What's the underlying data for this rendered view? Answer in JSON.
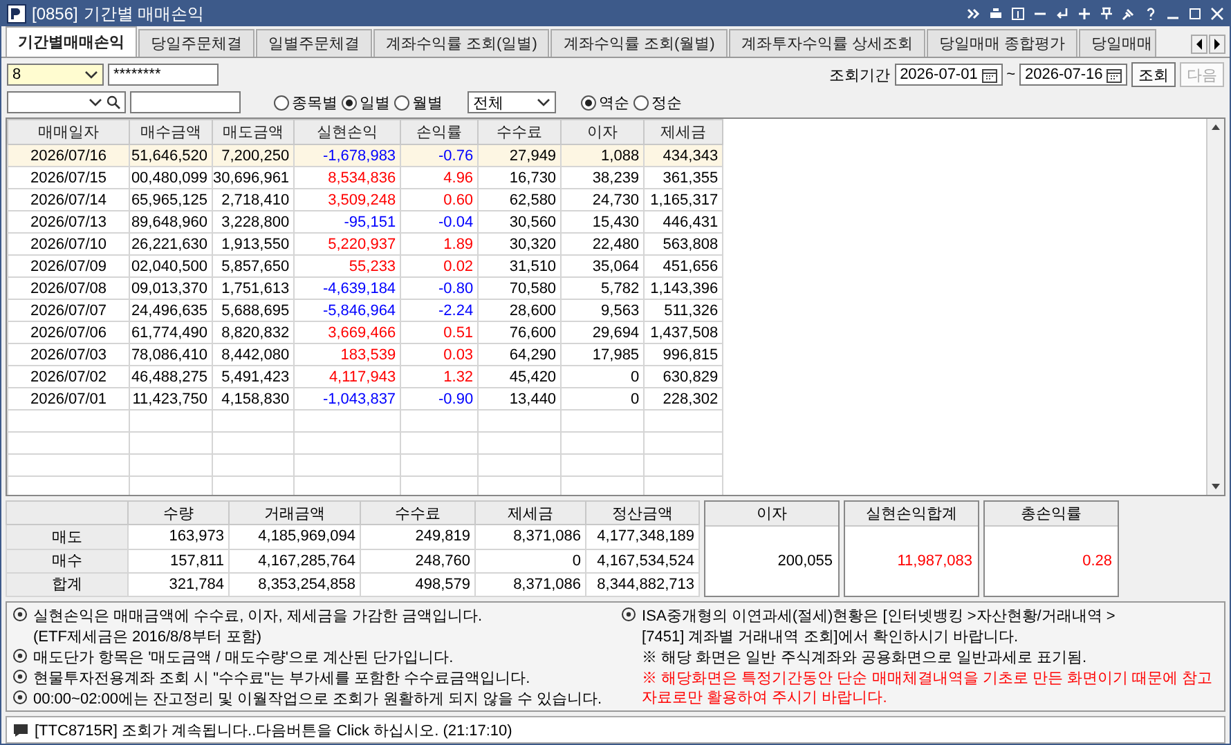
{
  "window": {
    "code": "[0856]",
    "title": "기간별 매매손익"
  },
  "tabs": [
    {
      "label": "기간별매매손익",
      "selected": true
    },
    {
      "label": "당일주문체결",
      "selected": false
    },
    {
      "label": "일별주문체결",
      "selected": false
    },
    {
      "label": "계좌수익률 조회(일별)",
      "selected": false
    },
    {
      "label": "계좌수익률 조회(월별)",
      "selected": false
    },
    {
      "label": "계좌투자수익률 상세조회",
      "selected": false
    },
    {
      "label": "당일매매 종합평가",
      "selected": false
    },
    {
      "label": "당일매매",
      "selected": false
    }
  ],
  "filters": {
    "account": "8",
    "password": "********",
    "period_label": "조회기간",
    "date_from": "2026-07-01",
    "date_sep": "~",
    "date_to": "2026-07-16",
    "query_button": {
      "label": "조회",
      "disabled": false
    },
    "next_button": {
      "label": "다음",
      "disabled": true
    },
    "view_options": [
      {
        "label": "종목별",
        "selected": false
      },
      {
        "label": "일별",
        "selected": true
      },
      {
        "label": "월별",
        "selected": false
      }
    ],
    "type_select": "전체",
    "order_options": [
      {
        "label": "역순",
        "selected": true
      },
      {
        "label": "정순",
        "selected": false
      }
    ]
  },
  "table": {
    "columns": [
      "매매일자",
      "매수금액",
      "매도금액",
      "실현손익",
      "손익률",
      "수수료",
      "이자",
      "제세금"
    ],
    "rows": [
      {
        "date": "2026/07/16",
        "buy": "51,646,520",
        "sell": "7,200,250",
        "pnl": "-1,678,983",
        "rate": "-0.76",
        "fee": "27,949",
        "interest": "1,088",
        "tax": "434,343",
        "loss": true,
        "selected": true
      },
      {
        "date": "2026/07/15",
        "buy": "00,480,099",
        "sell": "30,696,961",
        "pnl": "8,534,836",
        "rate": "4.96",
        "fee": "16,730",
        "interest": "38,239",
        "tax": "361,355",
        "loss": false,
        "selected": false
      },
      {
        "date": "2026/07/14",
        "buy": "65,965,125",
        "sell": "2,718,410",
        "pnl": "3,509,248",
        "rate": "0.60",
        "fee": "62,580",
        "interest": "24,730",
        "tax": "1,165,317",
        "loss": false,
        "selected": false
      },
      {
        "date": "2026/07/13",
        "buy": "89,648,960",
        "sell": "3,228,800",
        "pnl": "-95,151",
        "rate": "-0.04",
        "fee": "30,560",
        "interest": "15,430",
        "tax": "446,431",
        "loss": true,
        "selected": false
      },
      {
        "date": "2026/07/10",
        "buy": "26,221,630",
        "sell": "1,913,550",
        "pnl": "5,220,937",
        "rate": "1.89",
        "fee": "30,320",
        "interest": "22,480",
        "tax": "563,808",
        "loss": false,
        "selected": false
      },
      {
        "date": "2026/07/09",
        "buy": "02,040,500",
        "sell": "5,857,650",
        "pnl": "55,233",
        "rate": "0.02",
        "fee": "31,510",
        "interest": "35,064",
        "tax": "451,656",
        "loss": false,
        "selected": false
      },
      {
        "date": "2026/07/08",
        "buy": "09,013,370",
        "sell": "1,751,613",
        "pnl": "-4,639,184",
        "rate": "-0.80",
        "fee": "70,580",
        "interest": "5,782",
        "tax": "1,143,396",
        "loss": true,
        "selected": false
      },
      {
        "date": "2026/07/07",
        "buy": "24,496,635",
        "sell": "5,688,695",
        "pnl": "-5,846,964",
        "rate": "-2.24",
        "fee": "28,600",
        "interest": "9,563",
        "tax": "511,326",
        "loss": true,
        "selected": false
      },
      {
        "date": "2026/07/06",
        "buy": "61,774,490",
        "sell": "8,820,832",
        "pnl": "3,669,466",
        "rate": "0.51",
        "fee": "76,600",
        "interest": "29,694",
        "tax": "1,437,508",
        "loss": false,
        "selected": false
      },
      {
        "date": "2026/07/03",
        "buy": "78,086,410",
        "sell": "8,442,080",
        "pnl": "183,539",
        "rate": "0.03",
        "fee": "64,290",
        "interest": "17,985",
        "tax": "996,815",
        "loss": false,
        "selected": false
      },
      {
        "date": "2026/07/02",
        "buy": "46,488,275",
        "sell": "5,491,423",
        "pnl": "4,117,943",
        "rate": "1.32",
        "fee": "45,420",
        "interest": "0",
        "tax": "630,829",
        "loss": false,
        "selected": false
      },
      {
        "date": "2026/07/01",
        "buy": "11,423,750",
        "sell": "4,158,830",
        "pnl": "-1,043,837",
        "rate": "-0.90",
        "fee": "13,440",
        "interest": "0",
        "tax": "228,302",
        "loss": true,
        "selected": false
      }
    ]
  },
  "summary": {
    "columns": [
      "수량",
      "거래금액",
      "수수료",
      "제세금",
      "정산금액"
    ],
    "rows": [
      {
        "label": "매도",
        "values": [
          "163,973",
          "4,185,969,094",
          "249,819",
          "8,371,086",
          "4,177,348,189"
        ]
      },
      {
        "label": "매수",
        "values": [
          "157,811",
          "4,167,285,764",
          "248,760",
          "0",
          "4,167,534,524"
        ]
      },
      {
        "label": "합계",
        "values": [
          "321,784",
          "8,353,254,858",
          "498,579",
          "8,371,086",
          "8,344,882,713"
        ]
      }
    ],
    "interest": {
      "label": "이자",
      "value": "200,055",
      "emphasis": false
    },
    "realized": {
      "label": "실현손익합계",
      "value": "11,987,083",
      "emphasis": true
    },
    "total_rate": {
      "label": "총손익률",
      "value": "0.28",
      "emphasis": true
    }
  },
  "notes_left": [
    {
      "text": "실현손익은 매매금액에 수수료, 이자, 제세금을 가감한 금액입니다.",
      "bullet": true,
      "alert": false
    },
    {
      "text": "(ETF제세금은 2016/8/8부터 포함)",
      "bullet": false,
      "alert": false
    },
    {
      "text": "매도단가 항목은 '매도금액 / 매도수량'으로 계산된 단가입니다.",
      "bullet": true,
      "alert": false
    },
    {
      "text": "현물투자전용계좌 조회 시 \"수수료\"는 부가세를 포함한 수수료금액입니다.",
      "bullet": true,
      "alert": false
    },
    {
      "text": "00:00~02:00에는 잔고정리 및 이월작업으로 조회가 원활하게 되지 않을 수 있습니다.",
      "bullet": true,
      "alert": false
    }
  ],
  "notes_right": [
    {
      "text": "ISA중개형의 이연과세(절세)현황은 [인터넷뱅킹 >자산현황/거래내역 >",
      "bullet": true,
      "alert": false
    },
    {
      "text": "[7451] 계좌별 거래내역 조회]에서 확인하시기 바랍니다.",
      "bullet": false,
      "alert": false
    },
    {
      "text": "※ 해당 화면은 일반 주식계좌와 공용화면으로 일반과세로 표기됨.",
      "bullet": false,
      "alert": false
    },
    {
      "text": "※ 해당화면은 특정기간동안 단순 매매체결내역을 기초로 만든 화면이기 때문에 참고자료로만 활용하여 주시기 바랍니다.",
      "bullet": false,
      "alert": true
    }
  ],
  "status_bar": {
    "message": "[TTC8715R] 조회가 계속됩니다..다음버튼을 Click 하십시오. (21:17:10)"
  }
}
